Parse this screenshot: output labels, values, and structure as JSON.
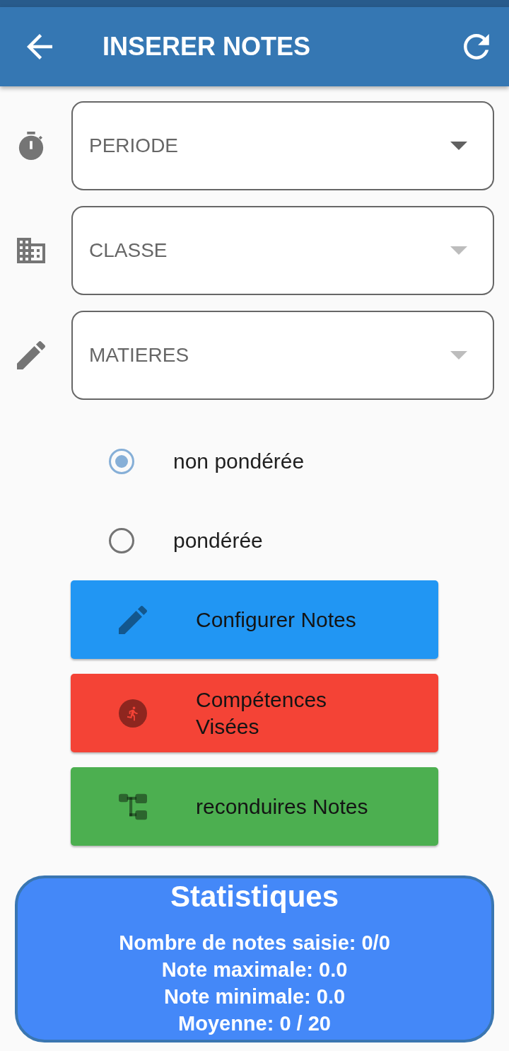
{
  "app_bar": {
    "title": "INSERER NOTES"
  },
  "fields": [
    {
      "placeholder": "PERIODE",
      "disabled": false
    },
    {
      "placeholder": "CLASSE",
      "disabled": true
    },
    {
      "placeholder": "MATIERES",
      "disabled": true
    }
  ],
  "options": [
    {
      "label": "non pondérée",
      "selected": true
    },
    {
      "label": "pondérée",
      "selected": false
    }
  ],
  "actions": [
    {
      "label": "Configurer Notes",
      "color": "#2196f3"
    },
    {
      "label": "Compétences Visées",
      "color": "#f44336"
    },
    {
      "label": "reconduires Notes",
      "color": "#4caf50"
    }
  ],
  "statistics": {
    "title": "Statistiques",
    "lines": [
      "Nombre de notes saisie: 0/0",
      "Note maximale: 0.0",
      "Note minimale: 0.0",
      "Moyenne: 0 / 20"
    ]
  }
}
